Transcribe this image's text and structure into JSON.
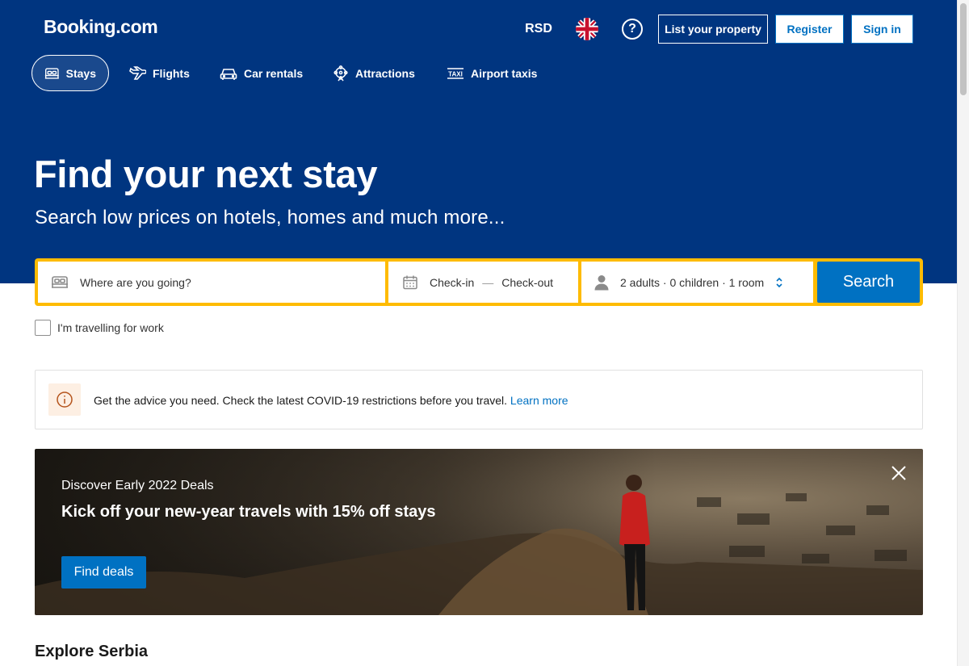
{
  "header": {
    "logo": "Booking.com",
    "currency": "RSD",
    "language_icon": "uk-flag-icon",
    "help_icon": "question-circle-icon",
    "help_glyph": "?",
    "list_property": "List your property",
    "register": "Register",
    "sign_in": "Sign in"
  },
  "nav": [
    {
      "label": "Stays",
      "icon": "bed-icon",
      "active": true
    },
    {
      "label": "Flights",
      "icon": "plane-icon",
      "active": false
    },
    {
      "label": "Car rentals",
      "icon": "car-icon",
      "active": false
    },
    {
      "label": "Attractions",
      "icon": "attractions-icon",
      "active": false
    },
    {
      "label": "Airport taxis",
      "icon": "taxi-icon",
      "active": false
    }
  ],
  "hero": {
    "title": "Find your next stay",
    "subtitle": "Search low prices on hotels, homes and much more..."
  },
  "search": {
    "destination_placeholder": "Where are you going?",
    "check_in": "Check-in",
    "date_separator": "—",
    "check_out": "Check-out",
    "guests": "2 adults · 0 children · 1 room",
    "button": "Search"
  },
  "work_travel": {
    "label": "I'm travelling for work",
    "checked": false
  },
  "advice": {
    "text": "Get the advice you need. Check the latest COVID-19 restrictions before you travel. ",
    "link": "Learn more"
  },
  "promo": {
    "kicker": "Discover Early 2022 Deals",
    "title": "Kick off your new-year travels with 15% off stays",
    "button": "Find deals"
  },
  "section_title": "Explore Serbia",
  "colors": {
    "brand_blue": "#003580",
    "action_blue": "#0071c2",
    "search_border": "#febb02"
  }
}
